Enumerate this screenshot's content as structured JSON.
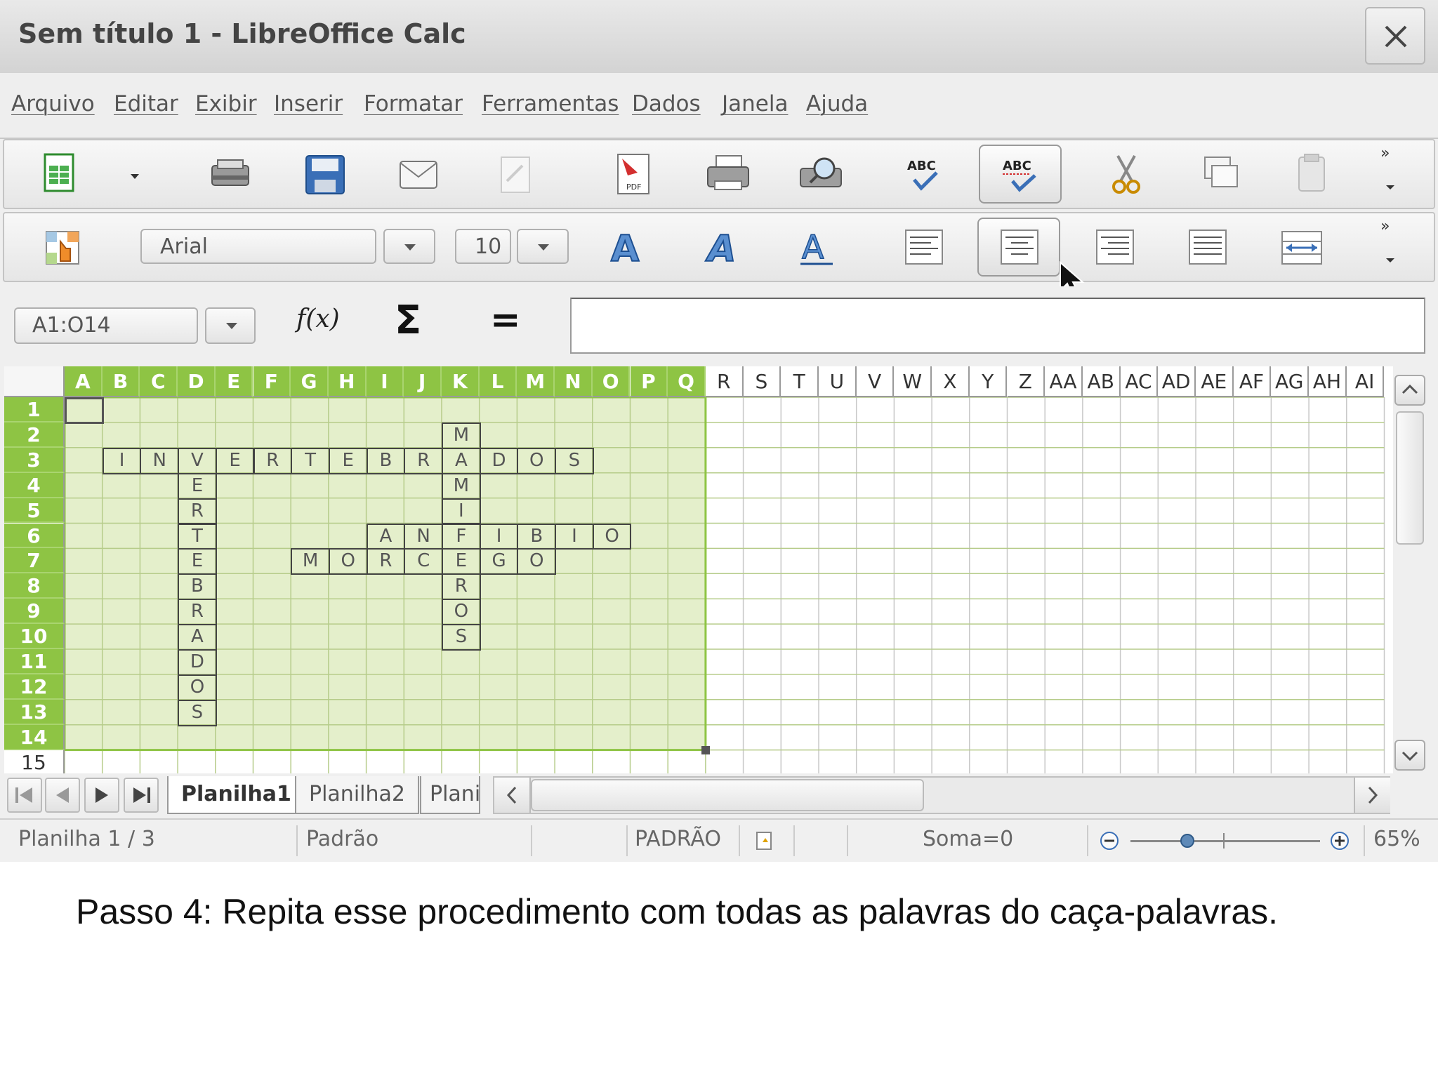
{
  "window": {
    "title": "Sem título 1 - LibreOffice Calc"
  },
  "menu": [
    "Arquivo",
    "Editar",
    "Exibir",
    "Inserir",
    "Formatar",
    "Ferramentas",
    "Dados",
    "Janela",
    "Ajuda"
  ],
  "toolbar_std": {
    "icons": [
      "new-spreadsheet-icon",
      "dropdown-arrow-icon",
      "open-folder-icon",
      "save-icon",
      "email-icon",
      "edit-file-icon",
      "export-pdf-icon",
      "print-icon",
      "print-preview-icon",
      "spellcheck-icon",
      "autospellcheck-icon",
      "cut-icon",
      "copy-icon",
      "paste-icon"
    ],
    "overflow": "»"
  },
  "toolbar_fmt": {
    "font_name": "Arial",
    "font_size": "10",
    "overflow": "»"
  },
  "formula_bar": {
    "name_box": "A1:O14",
    "fx": "f(x)",
    "sum": "Σ",
    "equals": "=",
    "content": ""
  },
  "sheet": {
    "columns": [
      "A",
      "B",
      "C",
      "D",
      "E",
      "F",
      "G",
      "H",
      "I",
      "J",
      "K",
      "L",
      "M",
      "N",
      "O",
      "P",
      "Q",
      "R",
      "S",
      "T",
      "U",
      "V",
      "W",
      "X",
      "Y",
      "Z",
      "AA",
      "AB",
      "AC",
      "AD",
      "AE",
      "AF",
      "AG",
      "AH",
      "AI"
    ],
    "rows": [
      "1",
      "2",
      "3",
      "4",
      "5",
      "6",
      "7",
      "8",
      "9",
      "10",
      "11",
      "12",
      "13",
      "14",
      "15"
    ],
    "selected_columns": 17,
    "selected_rows": 14,
    "highlight_color": "#8ec444",
    "selection_fill": "#e4efcb",
    "cells": [
      {
        "r": 2,
        "c": 10,
        "v": "M"
      },
      {
        "r": 3,
        "c": 1,
        "v": "I"
      },
      {
        "r": 3,
        "c": 2,
        "v": "N"
      },
      {
        "r": 3,
        "c": 3,
        "v": "V"
      },
      {
        "r": 3,
        "c": 4,
        "v": "E"
      },
      {
        "r": 3,
        "c": 5,
        "v": "R"
      },
      {
        "r": 3,
        "c": 6,
        "v": "T"
      },
      {
        "r": 3,
        "c": 7,
        "v": "E"
      },
      {
        "r": 3,
        "c": 8,
        "v": "B"
      },
      {
        "r": 3,
        "c": 9,
        "v": "R"
      },
      {
        "r": 3,
        "c": 10,
        "v": "A"
      },
      {
        "r": 3,
        "c": 11,
        "v": "D"
      },
      {
        "r": 3,
        "c": 12,
        "v": "O"
      },
      {
        "r": 3,
        "c": 13,
        "v": "S"
      },
      {
        "r": 4,
        "c": 3,
        "v": "E"
      },
      {
        "r": 4,
        "c": 10,
        "v": "M"
      },
      {
        "r": 5,
        "c": 3,
        "v": "R"
      },
      {
        "r": 5,
        "c": 10,
        "v": "I"
      },
      {
        "r": 6,
        "c": 3,
        "v": "T"
      },
      {
        "r": 6,
        "c": 8,
        "v": "A"
      },
      {
        "r": 6,
        "c": 9,
        "v": "N"
      },
      {
        "r": 6,
        "c": 10,
        "v": "F"
      },
      {
        "r": 6,
        "c": 11,
        "v": "I"
      },
      {
        "r": 6,
        "c": 12,
        "v": "B"
      },
      {
        "r": 6,
        "c": 13,
        "v": "I"
      },
      {
        "r": 6,
        "c": 14,
        "v": "O"
      },
      {
        "r": 7,
        "c": 3,
        "v": "E"
      },
      {
        "r": 7,
        "c": 6,
        "v": "M"
      },
      {
        "r": 7,
        "c": 7,
        "v": "O"
      },
      {
        "r": 7,
        "c": 8,
        "v": "R"
      },
      {
        "r": 7,
        "c": 9,
        "v": "C"
      },
      {
        "r": 7,
        "c": 10,
        "v": "E"
      },
      {
        "r": 7,
        "c": 11,
        "v": "G"
      },
      {
        "r": 7,
        "c": 12,
        "v": "O"
      },
      {
        "r": 8,
        "c": 3,
        "v": "B"
      },
      {
        "r": 8,
        "c": 10,
        "v": "R"
      },
      {
        "r": 9,
        "c": 3,
        "v": "R"
      },
      {
        "r": 9,
        "c": 10,
        "v": "O"
      },
      {
        "r": 10,
        "c": 3,
        "v": "A"
      },
      {
        "r": 10,
        "c": 10,
        "v": "S"
      },
      {
        "r": 11,
        "c": 3,
        "v": "D"
      },
      {
        "r": 12,
        "c": 3,
        "v": "O"
      },
      {
        "r": 13,
        "c": 3,
        "v": "S"
      }
    ]
  },
  "tabs": [
    "Planilha1",
    "Planilha2",
    "Plani"
  ],
  "status": {
    "sheet": "Planilha 1 / 3",
    "style": "Padrão",
    "mode": "PADRÃO",
    "sum": "Soma=0",
    "zoom": "65%",
    "zoom_fraction": 0.3
  },
  "caption": "Passo 4: Repita esse procedimento com todas as palavras do caça-palavras."
}
